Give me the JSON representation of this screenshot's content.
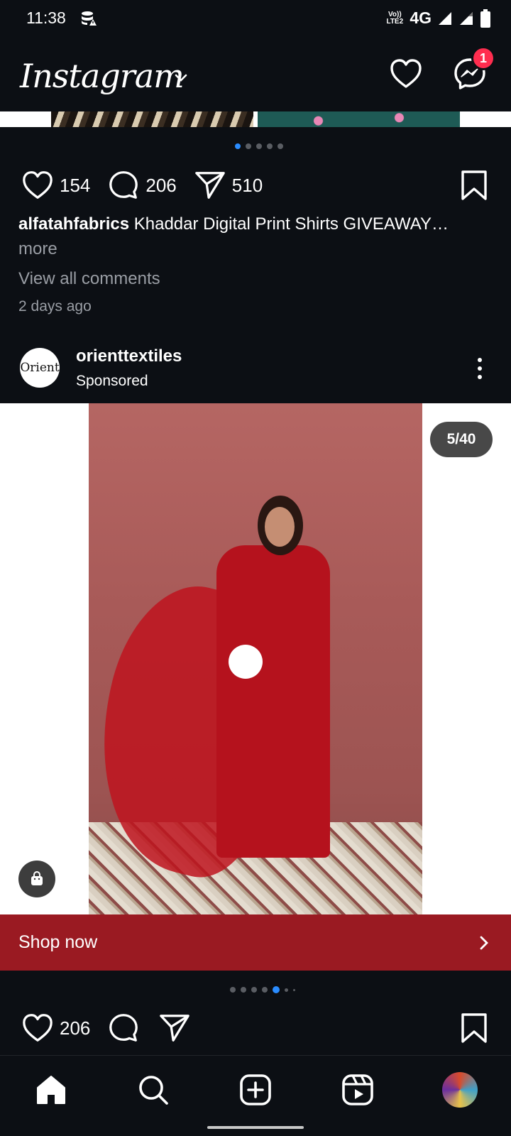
{
  "status_bar": {
    "time": "11:38",
    "network": "4G",
    "volte": "Vo)) LTE2"
  },
  "header": {
    "logo": "Instagram",
    "messages_badge": "1"
  },
  "prev_post": {
    "likes": "154",
    "comments": "206",
    "shares": "510",
    "username": "alfatahfabrics",
    "caption": "Khaddar Digital Print Shirts GIVEAWAY…",
    "more": "more",
    "view_comments": "View all comments",
    "time_ago": "2 days ago",
    "carousel": {
      "count": 5,
      "active_index": 0
    }
  },
  "sponsored_post": {
    "avatar_text": "Orient",
    "username": "orienttextiles",
    "label": "Sponsored",
    "counter": "5/40",
    "cta": "Shop now",
    "likes": "206",
    "carousel": {
      "count": 6,
      "active_index": 4
    }
  },
  "colors": {
    "accent_blue": "#2a8cff",
    "cta_red": "#9a1a22",
    "badge_red": "#ff2d4f",
    "background": "#0c0f14"
  },
  "icons": [
    "home-icon",
    "search-icon",
    "create-icon",
    "reels-icon",
    "heart-icon",
    "messenger-icon",
    "comment-icon",
    "share-icon",
    "bookmark-icon",
    "shopping-bag-icon",
    "chevron-right-icon"
  ]
}
